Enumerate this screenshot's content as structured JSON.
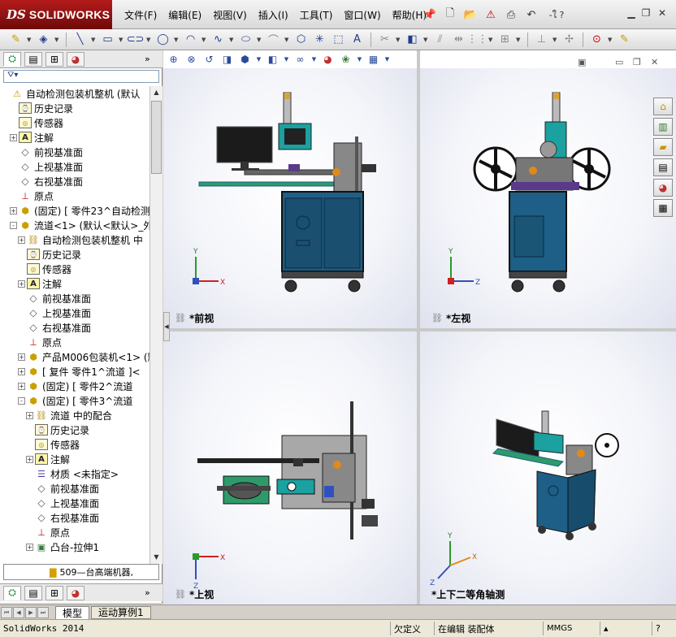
{
  "app": {
    "logo_ds": "DS",
    "logo_name": "SOLIDWORKS",
    "version_text": "SolidWorks 2014"
  },
  "menu": {
    "items": [
      "文件(F)",
      "编辑(E)",
      "视图(V)",
      "插入(I)",
      "工具(T)",
      "窗口(W)",
      "帮助(H)"
    ]
  },
  "quick_access": {
    "search_label": "-ใ ?"
  },
  "feature_tree": {
    "rows": [
      {
        "label": "自动检测包装机整机 (默认",
        "icon": "warn",
        "expand": "",
        "indent": 0
      },
      {
        "label": "历史记录",
        "icon": "hist",
        "expand": "",
        "indent": 1
      },
      {
        "label": "传感器",
        "icon": "sens",
        "expand": "",
        "indent": 1
      },
      {
        "label": "注解",
        "icon": "note",
        "expand": "+",
        "indent": 1
      },
      {
        "label": "前视基准面",
        "icon": "plane",
        "expand": "",
        "indent": 1
      },
      {
        "label": "上视基准面",
        "icon": "plane",
        "expand": "",
        "indent": 1
      },
      {
        "label": "右视基准面",
        "icon": "plane",
        "expand": "",
        "indent": 1
      },
      {
        "label": "原点",
        "icon": "org",
        "expand": "",
        "indent": 1
      },
      {
        "label": "(固定) [ 零件23^自动检测",
        "icon": "part",
        "expand": "+",
        "indent": 1
      },
      {
        "label": "流道<1> (默认<默认>_外",
        "icon": "part",
        "expand": "-",
        "indent": 1
      },
      {
        "label": "自动检测包装机整机 中",
        "icon": "mate",
        "expand": "+",
        "indent": 2
      },
      {
        "label": "历史记录",
        "icon": "hist",
        "expand": "",
        "indent": 2
      },
      {
        "label": "传感器",
        "icon": "sens",
        "expand": "",
        "indent": 2
      },
      {
        "label": "注解",
        "icon": "note",
        "expand": "+",
        "indent": 2
      },
      {
        "label": "前视基准面",
        "icon": "plane",
        "expand": "",
        "indent": 2
      },
      {
        "label": "上视基准面",
        "icon": "plane",
        "expand": "",
        "indent": 2
      },
      {
        "label": "右视基准面",
        "icon": "plane",
        "expand": "",
        "indent": 2
      },
      {
        "label": "原点",
        "icon": "org",
        "expand": "",
        "indent": 2
      },
      {
        "label": "产品M006包装机<1> (默",
        "icon": "part",
        "expand": "+",
        "indent": 2
      },
      {
        "label": "[ 复件 零件1^流道 ]<",
        "icon": "part",
        "expand": "+",
        "indent": 2
      },
      {
        "label": "(固定) [ 零件2^流道",
        "icon": "part",
        "expand": "+",
        "indent": 2
      },
      {
        "label": "(固定) [ 零件3^流道",
        "icon": "part",
        "expand": "-",
        "indent": 2
      },
      {
        "label": "流道 中的配合",
        "icon": "mate",
        "expand": "+",
        "indent": 3
      },
      {
        "label": "历史记录",
        "icon": "hist",
        "expand": "",
        "indent": 3
      },
      {
        "label": "传感器",
        "icon": "sens",
        "expand": "",
        "indent": 3
      },
      {
        "label": "注解",
        "icon": "note",
        "expand": "+",
        "indent": 3
      },
      {
        "label": "材质 <未指定>",
        "icon": "mat",
        "expand": "",
        "indent": 3
      },
      {
        "label": "前视基准面",
        "icon": "plane",
        "expand": "",
        "indent": 3
      },
      {
        "label": "上视基准面",
        "icon": "plane",
        "expand": "",
        "indent": 3
      },
      {
        "label": "右视基准面",
        "icon": "plane",
        "expand": "",
        "indent": 3
      },
      {
        "label": "原点",
        "icon": "org",
        "expand": "",
        "indent": 3
      },
      {
        "label": "凸台-拉伸1",
        "icon": "feat",
        "expand": "+",
        "indent": 3
      }
    ]
  },
  "folder_bar": {
    "label": "509—台高端机器,"
  },
  "viewports": [
    {
      "label": "*前视",
      "axes": [
        "Y",
        "X"
      ]
    },
    {
      "label": "*左视",
      "axes": [
        "Y",
        "Z"
      ]
    },
    {
      "label": "*上视",
      "axes": [
        "X",
        "Z"
      ]
    },
    {
      "label": "*上下二等角轴测",
      "axes": [
        "Y",
        "X",
        "Z"
      ]
    }
  ],
  "bottom_tabs": [
    "模型",
    "运动算例1"
  ],
  "status": {
    "under_defined": "欠定义",
    "editing": "在编辑 装配体",
    "units": "MMGS"
  },
  "colors": {
    "frame": "#1d5f86",
    "dark": "#222222",
    "accent": "#e08a1a",
    "teal": "#1aa1a0",
    "green": "#2e9a6a"
  }
}
